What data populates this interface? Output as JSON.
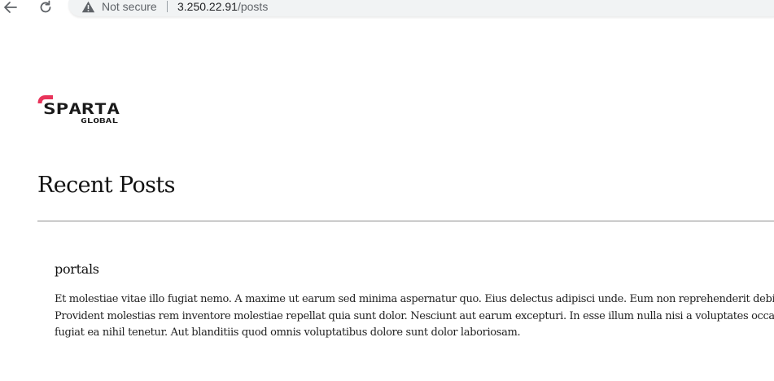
{
  "browser": {
    "security_label": "Not secure",
    "url_host": "3.250.22.91",
    "url_path": "/posts"
  },
  "logo": {
    "text": "SPARTA",
    "subtext": "GLOBAL",
    "accent_color": "#e8335a",
    "text_color": "#1a1a1a"
  },
  "page": {
    "title": "Recent Posts"
  },
  "posts": [
    {
      "title": "portals",
      "body_lines": [
        "Et molestiae vitae illo fugiat nemo. A maxime ut earum sed minima aspernatur quo. Eius delectus adipisci unde. Eum non reprehenderit debit",
        "Provident molestias rem inventore molestiae repellat quia sunt dolor. Nesciunt aut earum excepturi. In esse illum nulla nisi a voluptates occa",
        "fugiat ea nihil tenetur. Aut blanditiis quod omnis voluptatibus dolore sunt dolor laboriosam."
      ]
    }
  ]
}
